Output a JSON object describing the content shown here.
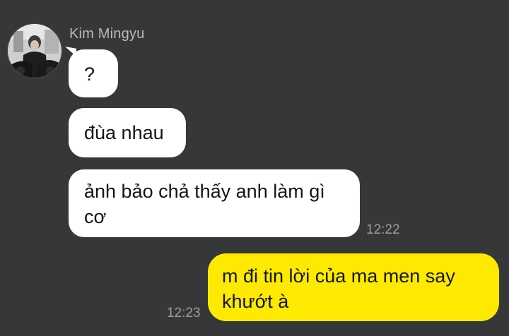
{
  "conversation": {
    "sender_name": "Kim Mingyu",
    "messages": [
      {
        "direction": "incoming",
        "text": "?"
      },
      {
        "direction": "incoming",
        "text": "đùa nhau"
      },
      {
        "direction": "incoming",
        "text": "ảnh bảo chả thấy anh làm gì cơ",
        "time": "12:22"
      },
      {
        "direction": "outgoing",
        "text": "m đi tin lời của ma men say khướt à",
        "time": "12:23"
      }
    ]
  },
  "colors": {
    "background": "#363738",
    "incoming_bubble": "#ffffff",
    "outgoing_bubble": "#fdea00",
    "timestamp_text": "#9b9c9e",
    "sender_name_text": "#b8b9bb"
  }
}
